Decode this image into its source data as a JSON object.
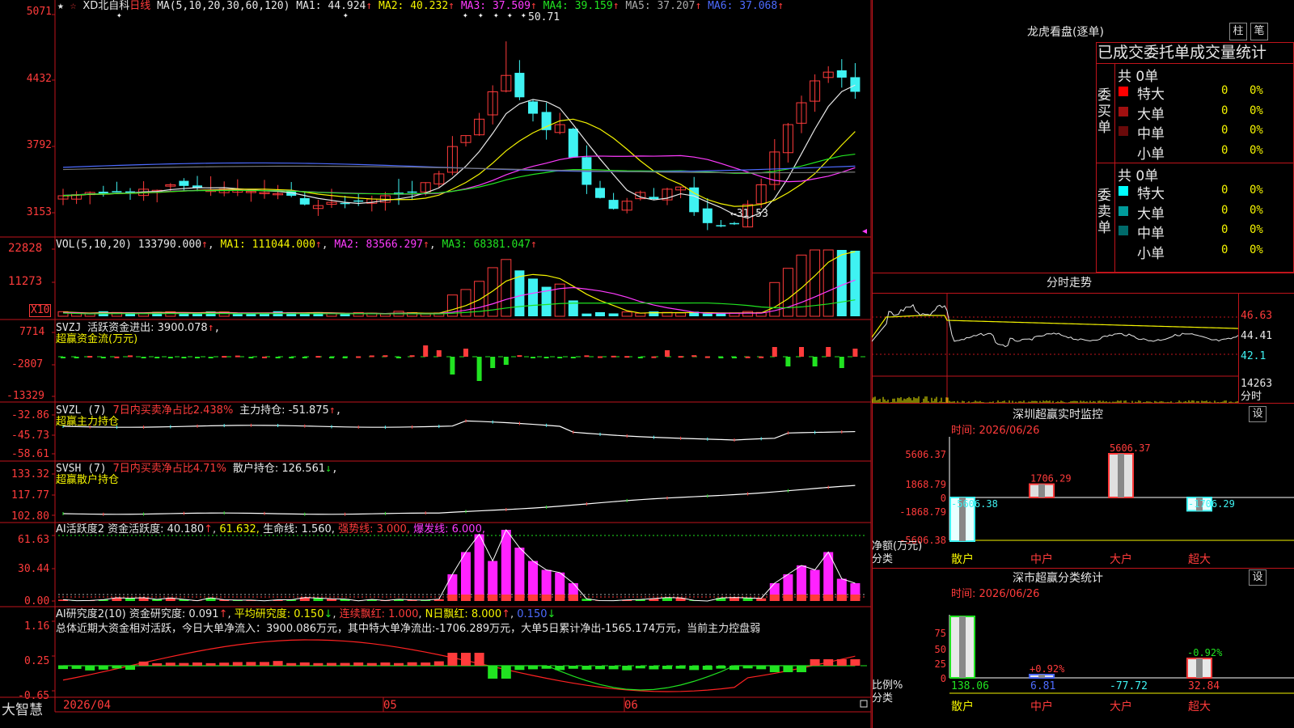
{
  "colors": {
    "up": "#ff3b3b",
    "down": "#3ff2f2",
    "grid": "#c0141b",
    "ma1": "#e8e8e8",
    "ma2": "#f4f400",
    "ma3": "#ff3bff",
    "ma4": "#21e321",
    "ma5": "#6e6e6e",
    "ma6": "#4d6bff"
  },
  "main": {
    "stock_name": "XD北自科",
    "period": "日线",
    "ma_label": "MA(5,10,20,30,60,120)",
    "ma_values": [
      {
        "name": "MA1:",
        "value": "44.924"
      },
      {
        "name": "MA2:",
        "value": "40.232"
      },
      {
        "name": "MA3:",
        "value": "37.509"
      },
      {
        "name": "MA4:",
        "value": "39.159"
      },
      {
        "name": "MA5:",
        "value": "37.207"
      },
      {
        "name": "MA6:",
        "value": "37.068"
      }
    ],
    "arrow_up": "↑",
    "arrow_down": "↓",
    "y_ticks": [
      "5071",
      "4432",
      "3792",
      "3153"
    ],
    "high_label": "50.71",
    "low_label": "←31.53"
  },
  "vol": {
    "label": "VOL(5,10,20)",
    "value": "133790.000",
    "ma1": "MA1: 111044.000",
    "ma2": "MA2: 83566.297",
    "ma3": "MA3: 68381.047",
    "y_ticks": [
      "22828",
      "11273"
    ],
    "unit_badge": "X10"
  },
  "svzj": {
    "name": "SVZJ",
    "label": "活跃资金进出: 3900.078",
    "sub": "超赢资金流(万元)",
    "y_ticks": [
      "7714",
      "-2807",
      "-13329"
    ]
  },
  "svzl": {
    "name": "SVZL (7)",
    "ratio": "7日内买卖净占比2.438%",
    "hold": "主力持仓: -51.875",
    "sub": "超赢主力持仓",
    "y_ticks": [
      "-32.86",
      "-45.73",
      "-58.61"
    ]
  },
  "svsh": {
    "name": "SVSH (7)",
    "ratio": "7日内买卖净占比4.71%",
    "hold": "散户持仓: 126.561",
    "sub": "超赢散户持仓",
    "y_ticks": [
      "133.32",
      "117.77",
      "102.80"
    ]
  },
  "ai1": {
    "name": "AI活跃度2",
    "val": "资金活跃度: 40.180",
    "v2": "61.632,",
    "life": "生命线: 1.560,",
    "strong": "强势线: 3.000,",
    "burst": "爆发线: 6.000,",
    "y_ticks": [
      "61.63",
      "30.44",
      "0.00"
    ]
  },
  "ai2": {
    "name": "AI研究度2(10)",
    "val": "资金研究度: 0.091",
    "avg": "平均研究度: 0.150",
    "cont": "连续飘红: 1.000",
    "nday": "N日飘红: 8.000",
    "last": "0.150",
    "summary": "总体近期大资金相对活跃，今日大单净流入：3900.086万元，其中特大单净流出:-1706.289万元，大单5日累计净出-1565.174万元，当前主力控盘弱",
    "y_ticks": [
      "1.16",
      "0.25",
      "-0.65"
    ]
  },
  "xaxis": {
    "d1": "2026/04",
    "d2": "05",
    "d3": "06"
  },
  "brand": "大智慧",
  "dragon": {
    "title": "龙虎看盘(逐单)",
    "btn1": "柱",
    "btn2": "笔",
    "header": "已成交委托单成交量统计",
    "buy_label": "委买单",
    "sell_label": "委卖单",
    "buy_total": "共 0单",
    "sell_total": "共 0单",
    "buy_rows": [
      {
        "name": "特大",
        "count": "0",
        "pct": "0%",
        "color": "#ff0000"
      },
      {
        "name": "大单",
        "count": "0",
        "pct": "0%",
        "color": "#a01010"
      },
      {
        "name": "中单",
        "count": "0",
        "pct": "0%",
        "color": "#6a0a0a"
      },
      {
        "name": "小单",
        "count": "0",
        "pct": "0%",
        "color": "#000000"
      }
    ],
    "sell_rows": [
      {
        "name": "特大",
        "count": "0",
        "pct": "0%",
        "color": "#00ffff"
      },
      {
        "name": "大单",
        "count": "0",
        "pct": "0%",
        "color": "#009a9a"
      },
      {
        "name": "中单",
        "count": "0",
        "pct": "0%",
        "color": "#006a6a"
      },
      {
        "name": "小单",
        "count": "0",
        "pct": "0%",
        "color": "#000000"
      }
    ]
  },
  "intraday": {
    "title": "分时走势",
    "p1": "46.63",
    "p2": "44.41",
    "p3": "42.1",
    "vol_label": "14263",
    "unit": "分时"
  },
  "sz_monitor": {
    "title": "深圳超赢实时监控",
    "btn": "设",
    "date": "时间: 2026/06/26",
    "y_ticks": [
      "5606.37",
      "1868.79",
      "0",
      "-1868.79",
      "-5606.38"
    ],
    "axis_label": "净额(万元)",
    "cat_label": "分类",
    "categories": [
      "散户",
      "中户",
      "大户",
      "超大"
    ],
    "values": [
      -5606.38,
      1706.29,
      5606.37,
      -1706.29
    ],
    "value_labels": [
      "-5606.38",
      "1706.29",
      "5606.37",
      "-1706.29"
    ]
  },
  "sz_class": {
    "title": "深市超赢分类统计",
    "btn": "设",
    "date": "时间: 2026/06/26",
    "y_ticks": [
      "75",
      "50",
      "25",
      "0"
    ],
    "axis_label": "比例%",
    "cat_label": "分类",
    "categories": [
      "散户",
      "中户",
      "大户",
      "超大"
    ],
    "pct": [
      75,
      0.92,
      0,
      0.92
    ],
    "pct_labels": [
      "",
      "+0.92%",
      "",
      "-0.92%"
    ],
    "values": [
      "138.06",
      "6.81",
      "-77.72",
      "32.84"
    ]
  }
}
